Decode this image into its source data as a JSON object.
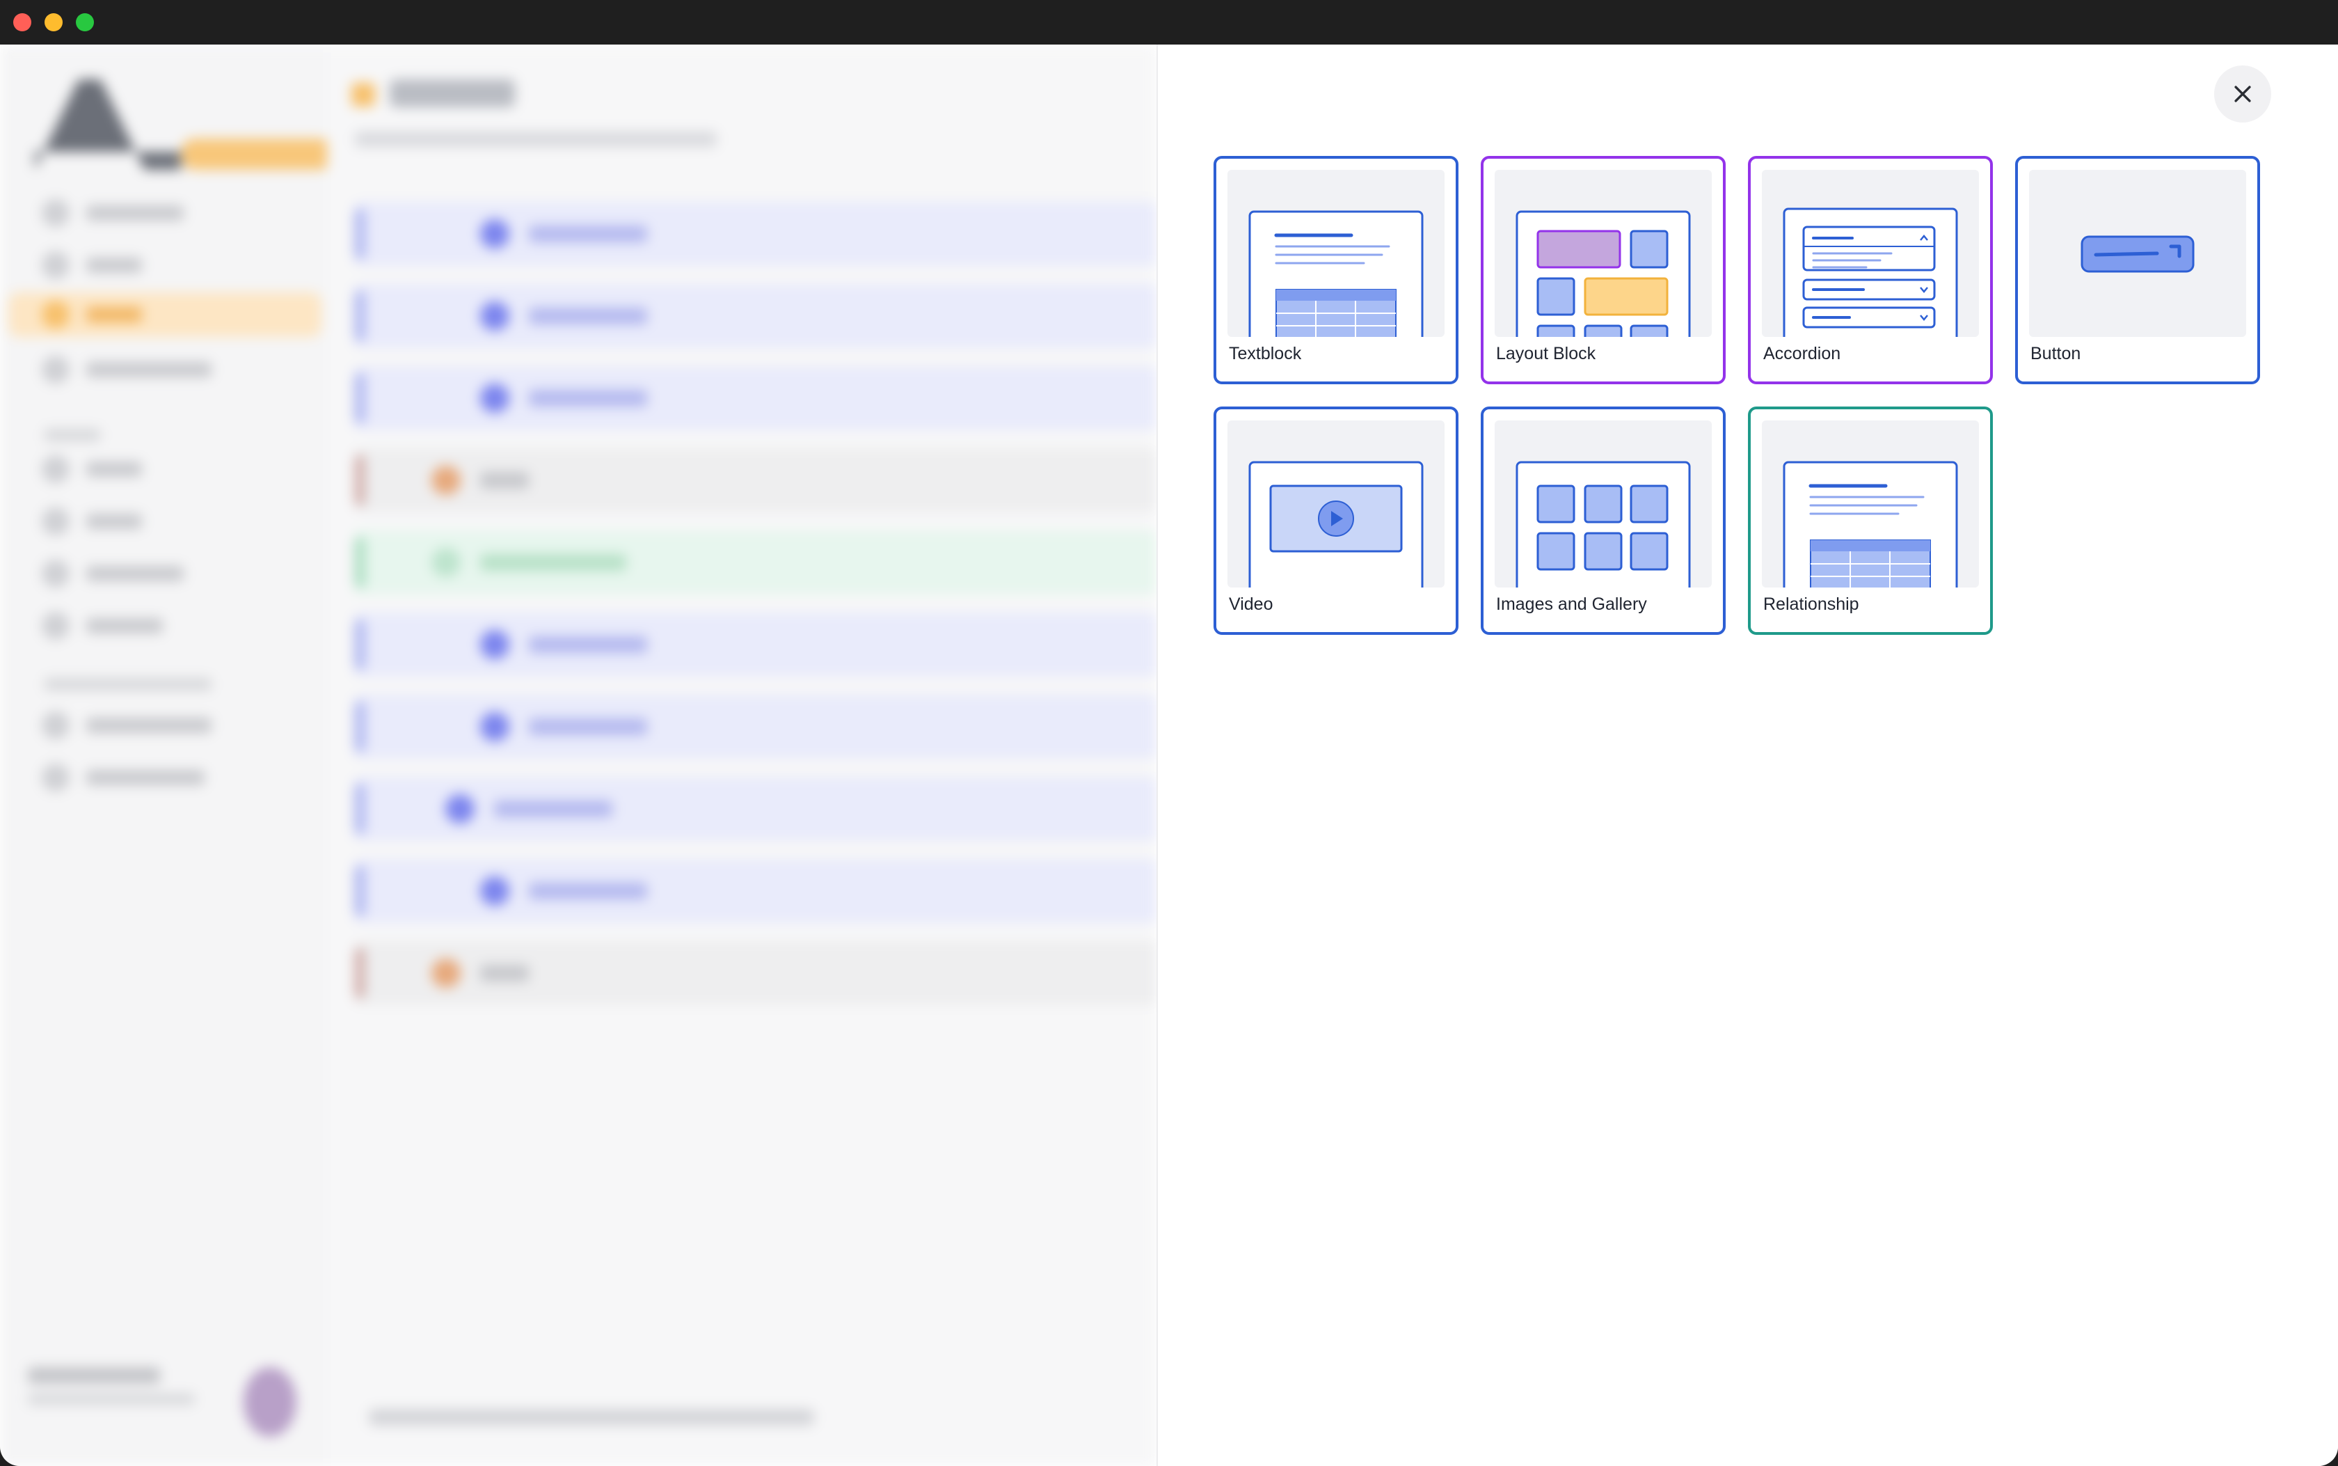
{
  "window": {
    "controls": [
      "close",
      "minimize",
      "zoom"
    ]
  },
  "modal": {
    "close_icon": "close-icon",
    "blocks": [
      {
        "label": "Textblock",
        "icon": "textblock-preview",
        "accent": "#2d5fd4"
      },
      {
        "label": "Layout Block",
        "icon": "layout-block-preview",
        "accent": "#9333ea"
      },
      {
        "label": "Accordion",
        "icon": "accordion-preview",
        "accent": "#9333ea"
      },
      {
        "label": "Button",
        "icon": "button-preview",
        "accent": "#2d5fd4"
      },
      {
        "label": "Video",
        "icon": "video-preview",
        "accent": "#2d5fd4"
      },
      {
        "label": "Images and Gallery",
        "icon": "gallery-preview",
        "accent": "#2d5fd4"
      },
      {
        "label": "Relationship",
        "icon": "relationship-preview",
        "accent": "#1f9a8a"
      }
    ]
  },
  "colors": {
    "accent_blue": "#2d5fd4",
    "accent_purple": "#9333ea",
    "accent_teal": "#1f9a8a",
    "preview_fill": "#a8bdf5",
    "preview_yellow": "#fdd58a",
    "preview_purple": "#c4a6dd"
  }
}
